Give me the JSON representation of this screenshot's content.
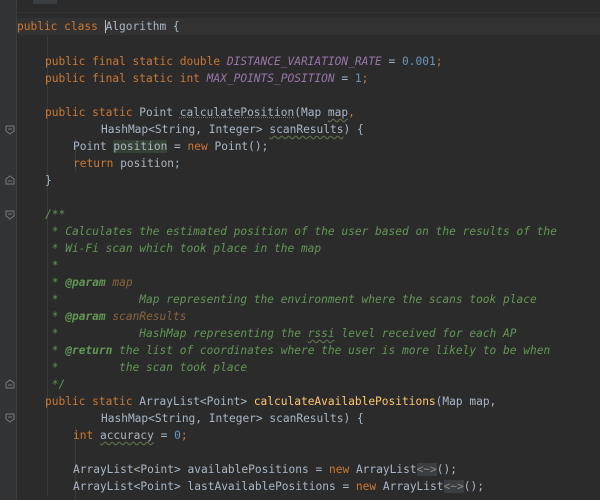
{
  "editor": {
    "theme": {
      "background": "#2b2b2b",
      "keyword": "#cc7832",
      "constant": "#9876aa",
      "number": "#6897bb",
      "method": "#ffc66d",
      "comment": "#629755"
    },
    "lines": {
      "l01": {
        "kw": "public class ",
        "pre": "",
        "caret_char": "A",
        "post": "lgorithm {"
      },
      "l02": {
        "kw": "public final static double ",
        "const": "DISTANCE_VARIATION_RATE",
        "op": " = ",
        "num": "0.001",
        "end": ";"
      },
      "l03": {
        "kw": "public final static int ",
        "const": "MAX_POINTS_POSITION",
        "op": " = ",
        "num": "1",
        "end": ";"
      },
      "l04": {
        "kw": "public static ",
        "type": "Point ",
        "fn": "calculatePosition",
        "open": "(Map ",
        "p1": "map",
        "sep": ",",
        "indent": ""
      },
      "l05": {
        "text": "HashMap<String, Integer> ",
        "p2": "scanResults",
        "end": ") {"
      },
      "l06": {
        "type": "Point ",
        "var": "position",
        "op": " = ",
        "kw": "new ",
        "end": "Point();"
      },
      "l07": {
        "kw": "return ",
        "end": "position;"
      },
      "l08": {
        "end": "}"
      },
      "l09": {
        "text": "/**"
      },
      "l10": {
        "text": " * Calculates the estimated position of the user based on the results of the"
      },
      "l11": {
        "text": " * Wi-Fi scan which took place in the map"
      },
      "l12": {
        "text": " *"
      },
      "l13": {
        "pre": " * ",
        "tag": "@param",
        "sp": " ",
        "name": "map"
      },
      "l14": {
        "text": " *            Map representing the environment where the scans took place"
      },
      "l15": {
        "pre": " * ",
        "tag": "@param",
        "sp": " ",
        "name": "scanResults"
      },
      "l16": {
        "pre": " *            HashMap representing the ",
        "word": "rssi",
        "post": " level received for each AP"
      },
      "l17": {
        "pre": " * ",
        "tag": "@return",
        "post": " the list of coordinates where the user is more likely to be when"
      },
      "l18": {
        "text": " *         the scan took place"
      },
      "l19": {
        "text": " */"
      },
      "l20": {
        "kw": "public static ",
        "type": "ArrayList<Point> ",
        "fn": "calculateAvailablePositions",
        "end": "(Map map,"
      },
      "l21": {
        "text": "HashMap<String, Integer> scanResults) {"
      },
      "l22": {
        "kw": "int ",
        "var": "accuracy",
        "op": " = ",
        "num": "0",
        "end": ";"
      },
      "l23": {
        "type": "ArrayList<Point> ",
        "var": "availablePositions",
        "op": " = ",
        "kw": "new ",
        "cls": "ArrayList",
        "diamond": "<~>",
        "end": "();"
      },
      "l24": {
        "type": "ArrayList<Point> ",
        "var": "lastAvailablePositions",
        "op": " = ",
        "kw": "new ",
        "cls": "ArrayList",
        "diamond": "<~>",
        "end": "();"
      }
    }
  }
}
